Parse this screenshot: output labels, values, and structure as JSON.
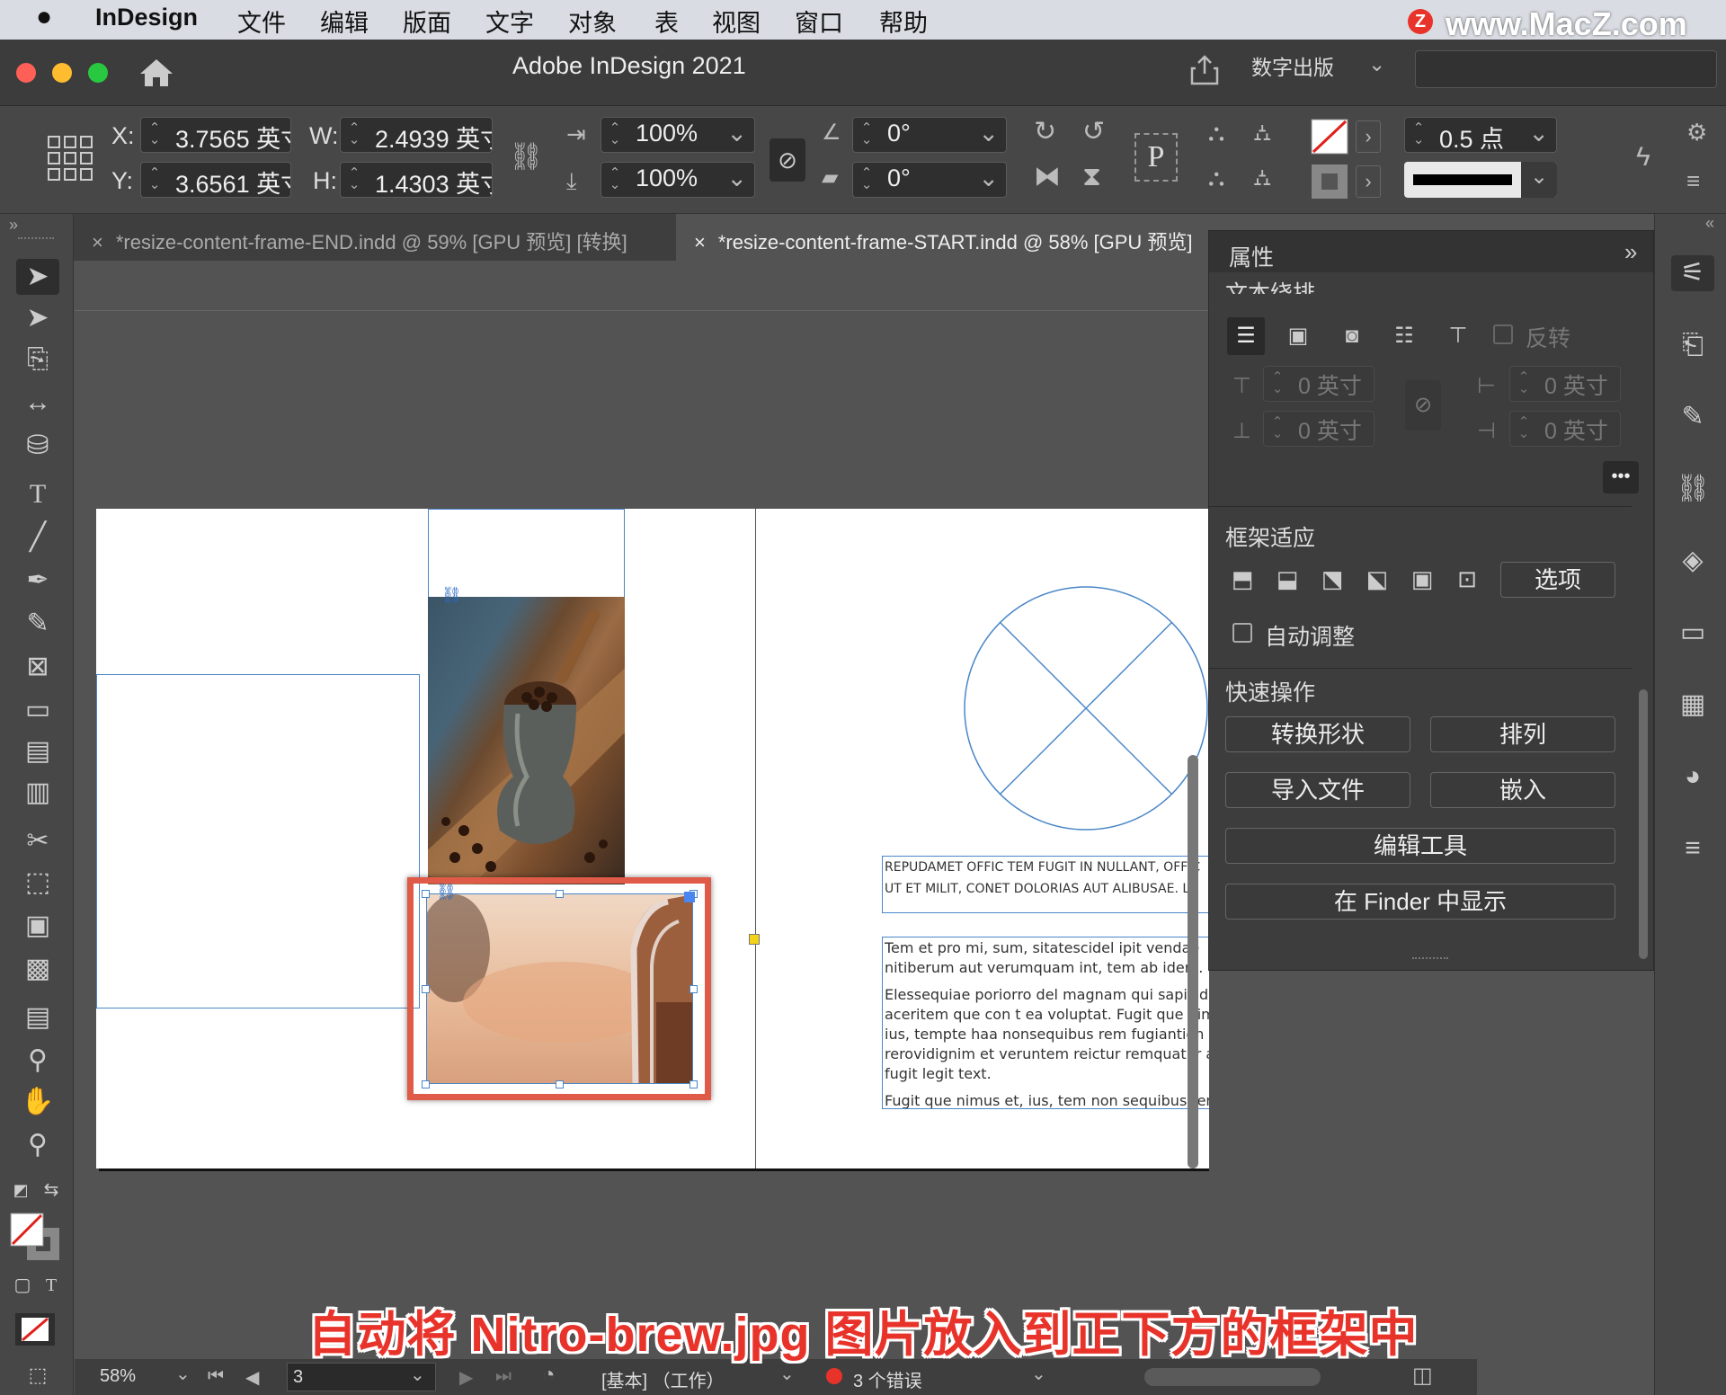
{
  "menubar": {
    "app": "InDesign",
    "items": [
      "文件",
      "编辑",
      "版面",
      "文字",
      "对象",
      "表",
      "视图",
      "窗口",
      "帮助"
    ],
    "watermark": "www.MacZ.com",
    "watermark_logo": "Z"
  },
  "titlebar": {
    "title": "Adobe InDesign 2021",
    "workspace": "数字出版"
  },
  "control": {
    "x_label": "X:",
    "x_value": "3.7565 英寸",
    "y_label": "Y:",
    "y_value": "3.6561 英寸",
    "w_label": "W:",
    "w_value": "2.4939 英寸",
    "h_label": "H:",
    "h_value": "1.4303 英寸",
    "scale_x": "100%",
    "scale_y": "100%",
    "rotate": "0°",
    "shear": "0°",
    "stroke_weight": "0.5 点"
  },
  "tabs": [
    {
      "label": "*resize-content-frame-END.indd @ 59% [GPU 预览] [转换]",
      "close": "×",
      "active": false
    },
    {
      "label": "*resize-content-frame-START.indd @ 58% [GPU 预览]",
      "close": "×",
      "active": true
    }
  ],
  "properties": {
    "title": "属性",
    "wrap_title": "文本绕排",
    "invert_label": "反转",
    "offset_top": "0 英寸",
    "offset_bottom": "0 英寸",
    "offset_left": "0 英寸",
    "offset_right": "0 英寸",
    "more": "•••",
    "frame_fit_title": "框架适应",
    "options_button": "选项",
    "auto_fit_label": "自动调整",
    "auto_fit_checked": false,
    "quick_actions_title": "快速操作",
    "convert_shape": "转换形状",
    "arrange": "排列",
    "import_file": "导入文件",
    "embed": "嵌入",
    "edit_with": "编辑工具",
    "reveal_finder": "在 Finder 中显示"
  },
  "document": {
    "caps_line1": "REPUDAMET OFFIC TEM FUGIT IN NULLANT, OFFIC",
    "caps_line2": "UT ET MILIT, CONET DOLORIAS AUT ALIBUSAE. L",
    "body_p1_l1": "Tem et pro mi, sum, sitatescidel ipit vendae",
    "body_p1_l2": "nitiberum aut verumquam int, tem ab idem.",
    "body_p2_l1": "Elessequiae poriorro del magnam qui sapicid usanis",
    "body_p2_l2": "aceritem que con t ea voluptat. Fugit que nimus et,",
    "body_p2_l3": "ius, tempte haa nonsequibus rem fugiantion my rero",
    "body_p2_l4": "rerovidignim et veruntem reictur remquatur archic tem",
    "body_p2_l5": "fugit legit text.",
    "body_p3_l1": "Fugit que nimus et, ius, tem non sequibus rem"
  },
  "status": {
    "zoom": "58%",
    "page": "3",
    "preflight_profile": "[基本] （工作）",
    "errors": "3 个错误"
  },
  "caption": "自动将 Nitro-brew.jpg 图片放入到正下方的框架中",
  "colors": {
    "accent_red": "#e8332a",
    "frame_blue": "#4a86c8",
    "selection_red": "#e05a48"
  }
}
